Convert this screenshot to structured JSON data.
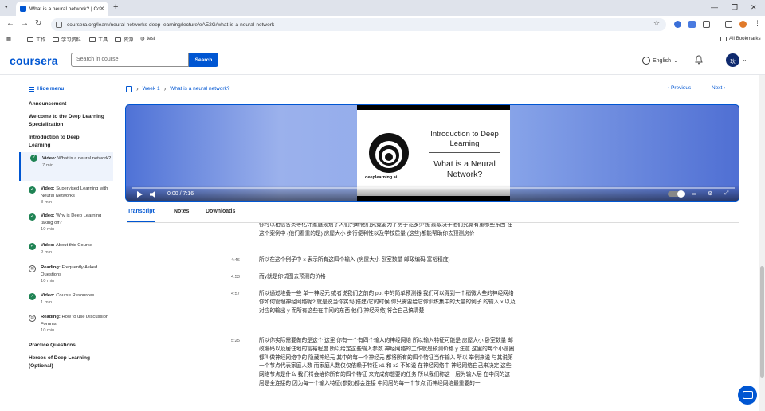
{
  "browser": {
    "tab_title": "What is a neural network? | Co...",
    "url": "coursera.org/learn/neural-networks-deep-learning/lecture/eAE2G/what-is-a-neural-network",
    "bookmarks": [
      "工作",
      "学习资料",
      "工具",
      "资源",
      "test"
    ],
    "all_bookmarks": "All Bookmarks"
  },
  "header": {
    "logo": "coursera",
    "search_placeholder": "Search in course",
    "search_button": "Search",
    "language": "English",
    "avatar_initials": "耿"
  },
  "sidebar": {
    "hide_menu": "Hide menu",
    "sections": [
      {
        "label": "Announcement"
      },
      {
        "label": "Welcome to the Deep Learning Specialization"
      },
      {
        "label": "Introduction to Deep Learning"
      },
      {
        "label": "Practice Questions"
      },
      {
        "label": "Heroes of Deep Learning (Optional)"
      }
    ],
    "items": [
      {
        "type": "Video:",
        "title": "What is a neural network?",
        "duration": "7 min",
        "icon": "check-icon"
      },
      {
        "type": "Video:",
        "title": "Supervised Learning with Neural Networks",
        "duration": "8 min",
        "icon": "check-icon"
      },
      {
        "type": "Video:",
        "title": "Why is Deep Learning taking off?",
        "duration": "10 min",
        "icon": "check-icon"
      },
      {
        "type": "Video:",
        "title": "About this Course",
        "duration": "2 min",
        "icon": "check-icon"
      },
      {
        "type": "Reading:",
        "title": "Frequently Asked Questions",
        "duration": "10 min",
        "icon": "reading-icon"
      },
      {
        "type": "Video:",
        "title": "Course Resources",
        "duration": "1 min",
        "icon": "check-icon"
      },
      {
        "type": "Reading:",
        "title": "How to use Discussion Forums",
        "duration": "10 min",
        "icon": "reading-icon"
      }
    ]
  },
  "breadcrumb": {
    "week": "Week 1",
    "lecture": "What is a neural network?"
  },
  "pager": {
    "previous": "Previous",
    "next": "Next"
  },
  "video": {
    "slide_title": "Introduction to Deep Learning",
    "slide_subtitle": "What is a Neural Network?",
    "slide_brand": "deeplearning.ai",
    "time": "0:00 / 7:16",
    "progress": 0
  },
  "content_tabs": [
    "Transcript",
    "Notes",
    "Downloads"
  ],
  "transcript": [
    {
      "time": "",
      "text": "例如就职是因为对你家庭的大小与卧室数量的帮助对家庭购买能力与保险 可以是们的邻居是否在运动的距离 你可以相信各类等估计家庭规划了人们判断他们究竟要为了房子花多少钱 最取决于他们究竟有重哪些东西 在这个案例中 (他们看重的是) 房屋大小 步行便利性以及学校质量 (这些)都能帮助你去预测房价"
    },
    {
      "time": "4:46",
      "text": "所以在这个例子中 x 表示所有这四个输入 (房屋大小 卧室数量 邮政编码 富裕程度)"
    },
    {
      "time": "4:53",
      "text": "而y就是你试图去预测的价格"
    },
    {
      "time": "4:57",
      "text": "所以通过堆叠一些 单一神经元 或者说我们之前的 ppt 中的简单预测器 我们可以得到一个稍微大些的神经网络 你如何管理神经网络呢? 就是说当你实现(搭建)它的时候 你只需要给它你训练集中的大量的例子 的输入 x 以及对应的输出 y 而所有这些在中间的东西 他们(神经网络)将会自己搞清楚"
    },
    {
      "time": "5:25",
      "text": "所以你实际需要做的是这个 这里 你有一个有四个输入的神经网络 所以输入特征可能是 房屋大小 卧室数量 邮政编码以及居住地的富裕程度 所以给定这些输入参数 神经网络的工作就是预测价格 y 注意 这里的每个小圆圈 都叫做神经网络中的 隐藏神经元 其中的每一个神经元 都将所有的四个特征当作输入 所以 举例来说 与其说第一个节点代表家庭人数 而家庭人数仅仅依赖于特征 x1 和 x2 不如说 在神经网络中 神经网络自己来决定 这些网络节点是什么 我们将会给你所有的四个特征 来完成你想要的任务 所以我们称这一层为输入层 在中间的这一层是全连接的 因为每一个输入特征(参数)都会连接 中间层的每一个节点 而神经网络最重要的一"
    }
  ]
}
